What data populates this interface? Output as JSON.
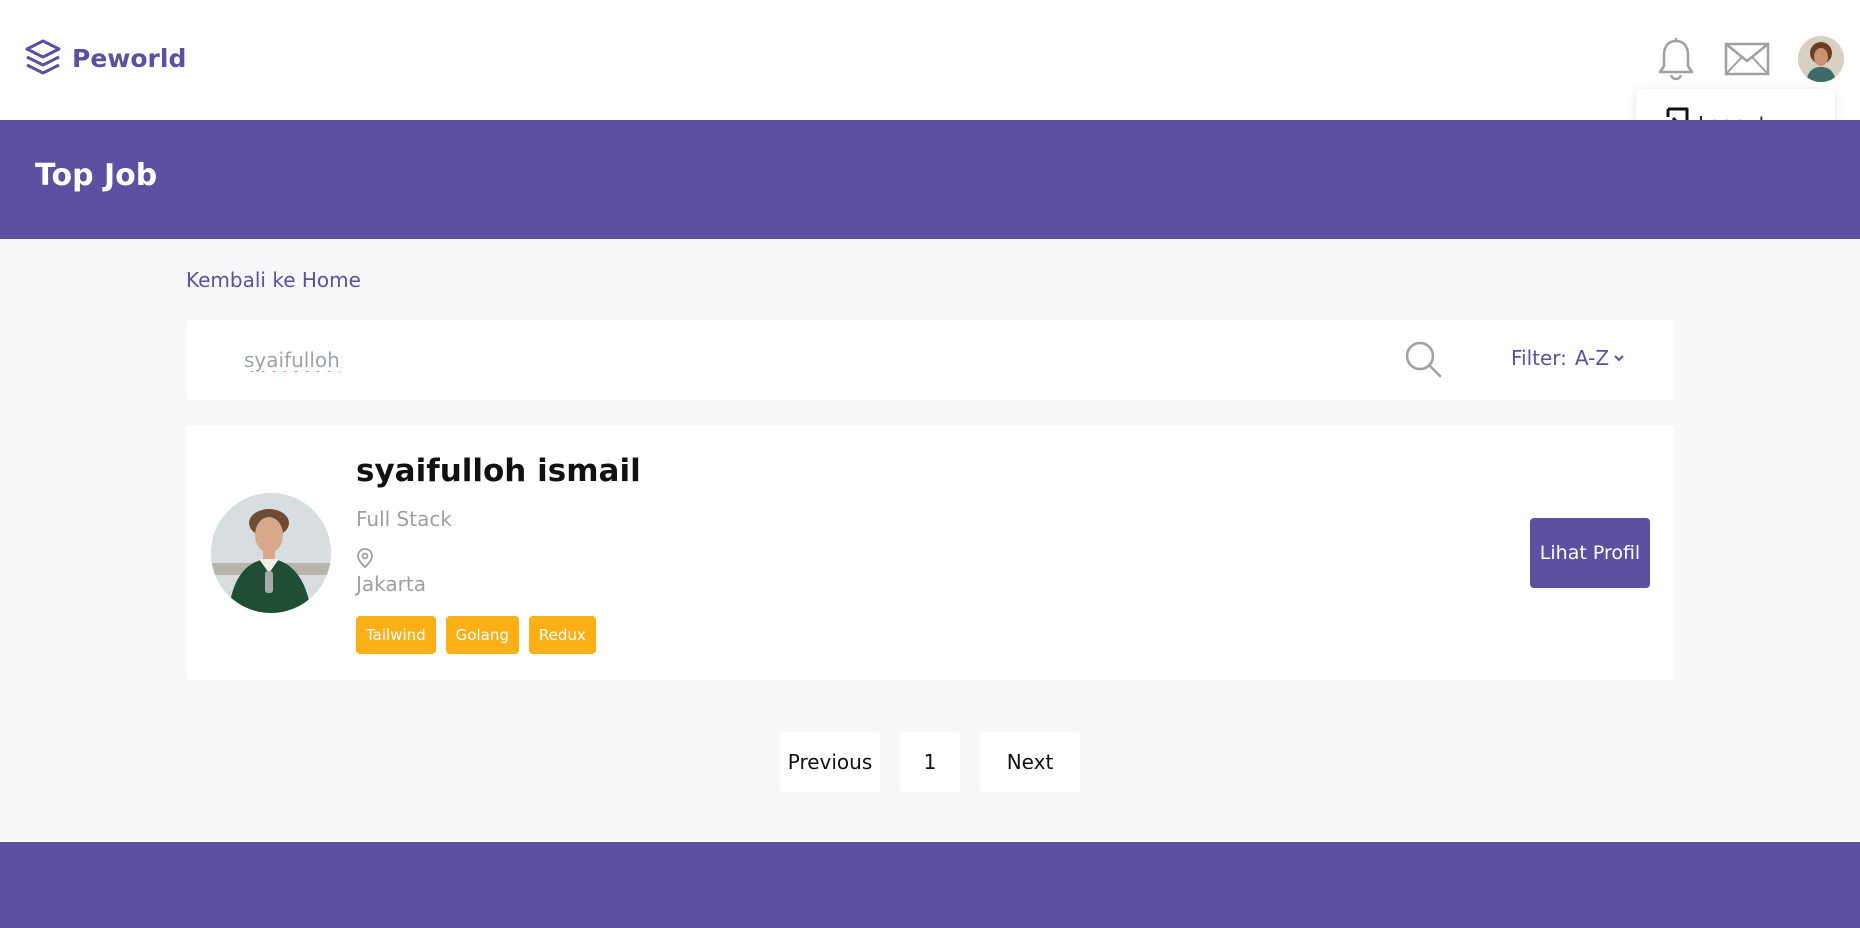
{
  "brand": {
    "name": "Peworld",
    "accent_color": "#5e50a1",
    "tag_color": "#fbb017"
  },
  "nav": {
    "notification_icon": "bell-icon",
    "message_icon": "mail-icon",
    "avatar_icon": "user-avatar"
  },
  "dropdown": {
    "logout_label": "Logout",
    "logout_icon": "logout-icon"
  },
  "banner": {
    "title": "Top Job"
  },
  "back_link": "Kembali ke Home",
  "search": {
    "value": "syaifulloh",
    "search_icon": "search-icon"
  },
  "filter": {
    "label": "Filter:",
    "value": "A-Z"
  },
  "results": [
    {
      "name": "syaifulloh ismail",
      "role": "Full Stack",
      "location": "Jakarta",
      "skills": [
        "Tailwind",
        "Golang",
        "Redux"
      ],
      "button_label": "Lihat Profil"
    }
  ],
  "pagination": {
    "previous": "Previous",
    "current_page": "1",
    "next": "Next"
  }
}
